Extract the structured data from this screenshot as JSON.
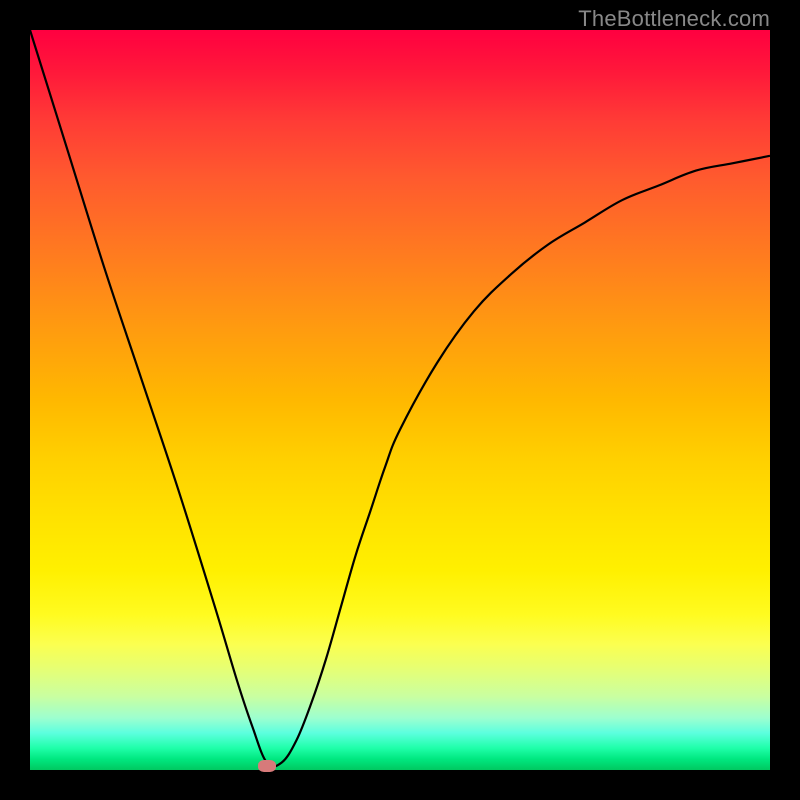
{
  "watermark": "TheBottleneck.com",
  "chart_data": {
    "type": "line",
    "title": "",
    "xlabel": "",
    "ylabel": "",
    "xlim": [
      0,
      100
    ],
    "ylim": [
      0,
      100
    ],
    "grid": false,
    "legend": false,
    "gradient_stops": [
      {
        "pos": 0.0,
        "color": "#ff0040"
      },
      {
        "pos": 0.5,
        "color": "#ffb800"
      },
      {
        "pos": 0.8,
        "color": "#ffff40"
      },
      {
        "pos": 1.0,
        "color": "#00d070"
      }
    ],
    "curve_color": "#000000",
    "curve_width": 2.2,
    "series": [
      {
        "name": "bottleneck-curve",
        "x": [
          0,
          5,
          10,
          15,
          20,
          25,
          28,
          30,
          32,
          34,
          36,
          38,
          40,
          42,
          44,
          46,
          48,
          50,
          55,
          60,
          65,
          70,
          75,
          80,
          85,
          90,
          95,
          100
        ],
        "values": [
          100,
          84,
          68,
          53,
          38,
          22,
          12,
          6,
          1,
          1,
          4,
          9,
          15,
          22,
          29,
          35,
          41,
          46,
          55,
          62,
          67,
          71,
          74,
          77,
          79,
          81,
          82,
          83
        ]
      }
    ],
    "marker": {
      "x": 32,
      "y": 0.5,
      "color": "#d77a7a"
    }
  }
}
